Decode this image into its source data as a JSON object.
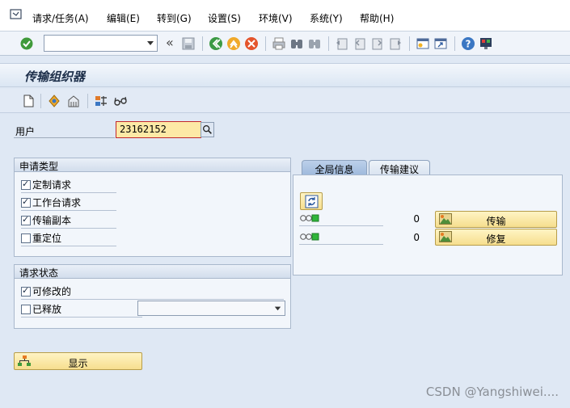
{
  "menu": {
    "items": [
      {
        "label": "请求/任务(A)"
      },
      {
        "label": "编辑(E)"
      },
      {
        "label": "转到(G)"
      },
      {
        "label": "设置(S)"
      },
      {
        "label": "环境(V)"
      },
      {
        "label": "系统(Y)"
      },
      {
        "label": "帮助(H)"
      }
    ]
  },
  "toolbar": {
    "command_value": "",
    "icons": [
      "enter-icon",
      "command-field",
      "back-arrows-icon",
      "save-icon",
      "back-icon",
      "exit-icon",
      "cancel-icon",
      "print-icon",
      "find-icon",
      "find-next-icon",
      "first-page-icon",
      "prev-page-icon",
      "next-page-icon",
      "last-page-icon",
      "new-session-icon",
      "shortcut-icon",
      "help-icon",
      "layout-icon"
    ]
  },
  "title": "传输组织器",
  "user_field": {
    "label": "用户",
    "value": "23162152"
  },
  "request_type": {
    "header": "申请类型",
    "options": [
      {
        "label": "定制请求",
        "checked": true
      },
      {
        "label": "工作台请求",
        "checked": true
      },
      {
        "label": "传输副本",
        "checked": true
      },
      {
        "label": "重定位",
        "checked": false
      }
    ]
  },
  "request_status": {
    "header": "请求状态",
    "options": [
      {
        "label": "可修改的",
        "checked": true
      },
      {
        "label": "已释放",
        "checked": false
      }
    ],
    "released_select_value": ""
  },
  "tabs": [
    {
      "label": "全局信息",
      "active": true
    },
    {
      "label": "传输建议",
      "active": false
    }
  ],
  "global_info": {
    "rows": [
      {
        "count": "0",
        "button": "传输"
      },
      {
        "count": "0",
        "button": "修复"
      }
    ]
  },
  "display_button": "显示",
  "watermark": "CSDN @Yangshiwei...."
}
